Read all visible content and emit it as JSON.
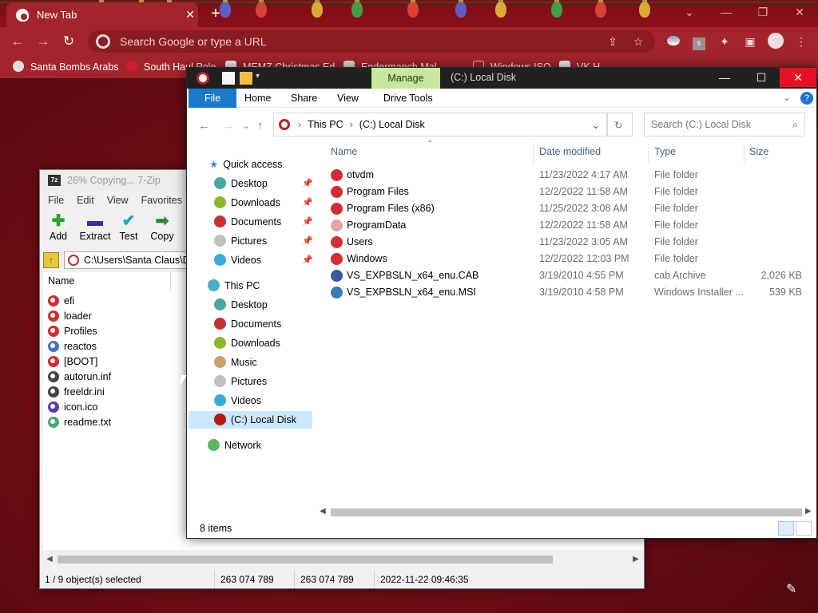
{
  "browser": {
    "tab_title": "New Tab",
    "tab_close": "✕",
    "new_tab": "+",
    "omnibox_placeholder": "Search Google or type a URL",
    "bookmarks": [
      {
        "label": "Santa Bombs Arabs",
        "color": "#e0e0e0"
      },
      {
        "label": "South Haul Pole",
        "color": "#d21d2b"
      },
      {
        "label": "MEMZ Christmas Ed...",
        "color": "#f1f1f1"
      },
      {
        "label": "Endermanch Mal...",
        "color": "#dedede"
      },
      {
        "label": "Windows ISO",
        "color": "#a3242b"
      },
      {
        "label": "VK H...",
        "color": "#eeeeee"
      }
    ],
    "window_controls": {
      "minimize": "—",
      "restore": "❐",
      "close": "✕",
      "tabsearch": "⌄"
    }
  },
  "sevenzip": {
    "title": "26% Copying... 7-Zip",
    "title_icon": "7z",
    "menu": [
      "File",
      "Edit",
      "View",
      "Favorites"
    ],
    "toolbar": [
      {
        "label": "Add",
        "glyph": "✚",
        "color": "#27a327"
      },
      {
        "label": "Extract",
        "glyph": "▬",
        "color": "#2636b0"
      },
      {
        "label": "Test",
        "glyph": "✔",
        "color": "#1aa6b8"
      },
      {
        "label": "Copy",
        "glyph": "➡",
        "color": "#2a8a2a"
      }
    ],
    "path": "C:\\Users\\Santa Claus\\D",
    "column_name": "Name",
    "files": [
      {
        "name": "efi",
        "color": "#d42c32"
      },
      {
        "name": "loader",
        "color": "#d42c32"
      },
      {
        "name": "Profiles",
        "color": "#d42c32"
      },
      {
        "name": "reactos",
        "color": "#4a72b8"
      },
      {
        "name": "[BOOT]",
        "color": "#d42c32"
      },
      {
        "name": "autorun.inf",
        "color": "#444"
      },
      {
        "name": "freeldr.ini",
        "color": "#444"
      },
      {
        "name": "icon.ico",
        "color": "#5a3aa8"
      },
      {
        "name": "readme.txt",
        "color": "#4aa878"
      }
    ],
    "status": {
      "selection": "1 / 9 object(s) selected",
      "size1": "263 074 789",
      "size2": "263 074 789",
      "date": "2022-11-22 09:46:35"
    },
    "scroll_left": "◀",
    "scroll_right": "▶"
  },
  "explorer": {
    "manage_tab": "Manage",
    "window_title": "(C:) Local Disk",
    "ribbon_tabs": [
      "File",
      "Home",
      "Share",
      "View",
      "Drive Tools"
    ],
    "breadcrumb": [
      "This PC",
      "(C:) Local Disk"
    ],
    "search_placeholder": "Search (C:) Local Disk",
    "nav": {
      "quick_access": "Quick access",
      "quick_items": [
        {
          "label": "Desktop",
          "color": "#48a8a0"
        },
        {
          "label": "Downloads",
          "color": "#8ab82a"
        },
        {
          "label": "Documents",
          "color": "#c83030"
        },
        {
          "label": "Pictures",
          "color": "#c0c0c0"
        },
        {
          "label": "Videos",
          "color": "#3aaad8"
        }
      ],
      "this_pc": "This PC",
      "pc_items": [
        {
          "label": "Desktop",
          "color": "#48a8a0"
        },
        {
          "label": "Documents",
          "color": "#c83030"
        },
        {
          "label": "Downloads",
          "color": "#8ab82a"
        },
        {
          "label": "Music",
          "color": "#c8a070"
        },
        {
          "label": "Pictures",
          "color": "#c0c0c0"
        },
        {
          "label": "Videos",
          "color": "#3aaad8"
        },
        {
          "label": "(C:) Local Disk",
          "color": "#b81818"
        }
      ],
      "network": "Network"
    },
    "columns": {
      "name": "Name",
      "date": "Date modified",
      "type": "Type",
      "size": "Size"
    },
    "rows": [
      {
        "name": "otvdm",
        "date": "11/23/2022 4:17 AM",
        "type": "File folder",
        "size": "",
        "color": "#d42c32"
      },
      {
        "name": "Program Files",
        "date": "12/2/2022 11:58 AM",
        "type": "File folder",
        "size": "",
        "color": "#d42c32"
      },
      {
        "name": "Program Files (x86)",
        "date": "11/25/2022 3:08 AM",
        "type": "File folder",
        "size": "",
        "color": "#d42c32"
      },
      {
        "name": "ProgramData",
        "date": "12/2/2022 11:58 AM",
        "type": "File folder",
        "size": "",
        "color": "#e6a3a6"
      },
      {
        "name": "Users",
        "date": "11/23/2022 3:05 AM",
        "type": "File folder",
        "size": "",
        "color": "#d42c32"
      },
      {
        "name": "Windows",
        "date": "12/2/2022 12:03 PM",
        "type": "File folder",
        "size": "",
        "color": "#d42c32"
      },
      {
        "name": "VS_EXPBSLN_x64_enu.CAB",
        "date": "3/19/2010 4:55 PM",
        "type": "cab Archive",
        "size": "2,026 KB",
        "color": "#3a5a9a"
      },
      {
        "name": "VS_EXPBSLN_x64_enu.MSI",
        "date": "3/19/2010 4:58 PM",
        "type": "Windows Installer ...",
        "size": "539 KB",
        "color": "#3a7aba"
      }
    ],
    "item_count": "8 items"
  }
}
